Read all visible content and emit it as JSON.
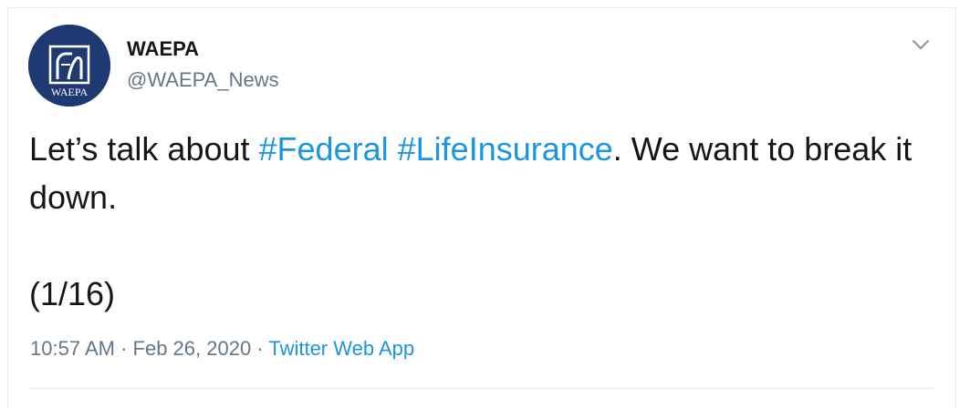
{
  "tweet": {
    "avatar": {
      "logo_text": "WAEPA",
      "background_color": "#1f3a72"
    },
    "author": {
      "display_name": "WAEPA",
      "handle": "@WAEPA_News"
    },
    "menu_icon": "chevron-down-icon",
    "text": {
      "part1": "Let’s talk about ",
      "hashtag1": "#Federal",
      "space": " ",
      "hashtag2": "#LifeInsurance",
      "part2": ". We want to break it down.",
      "counter": "(1/16)"
    },
    "meta": {
      "time": "10:57 AM",
      "separator1": " · ",
      "date": "Feb 26, 2020",
      "separator2": " · ",
      "source": "Twitter Web App"
    },
    "colors": {
      "text": "#14171a",
      "secondary": "#657786",
      "link": "#1b95e0",
      "border": "#e6ecf0"
    }
  }
}
